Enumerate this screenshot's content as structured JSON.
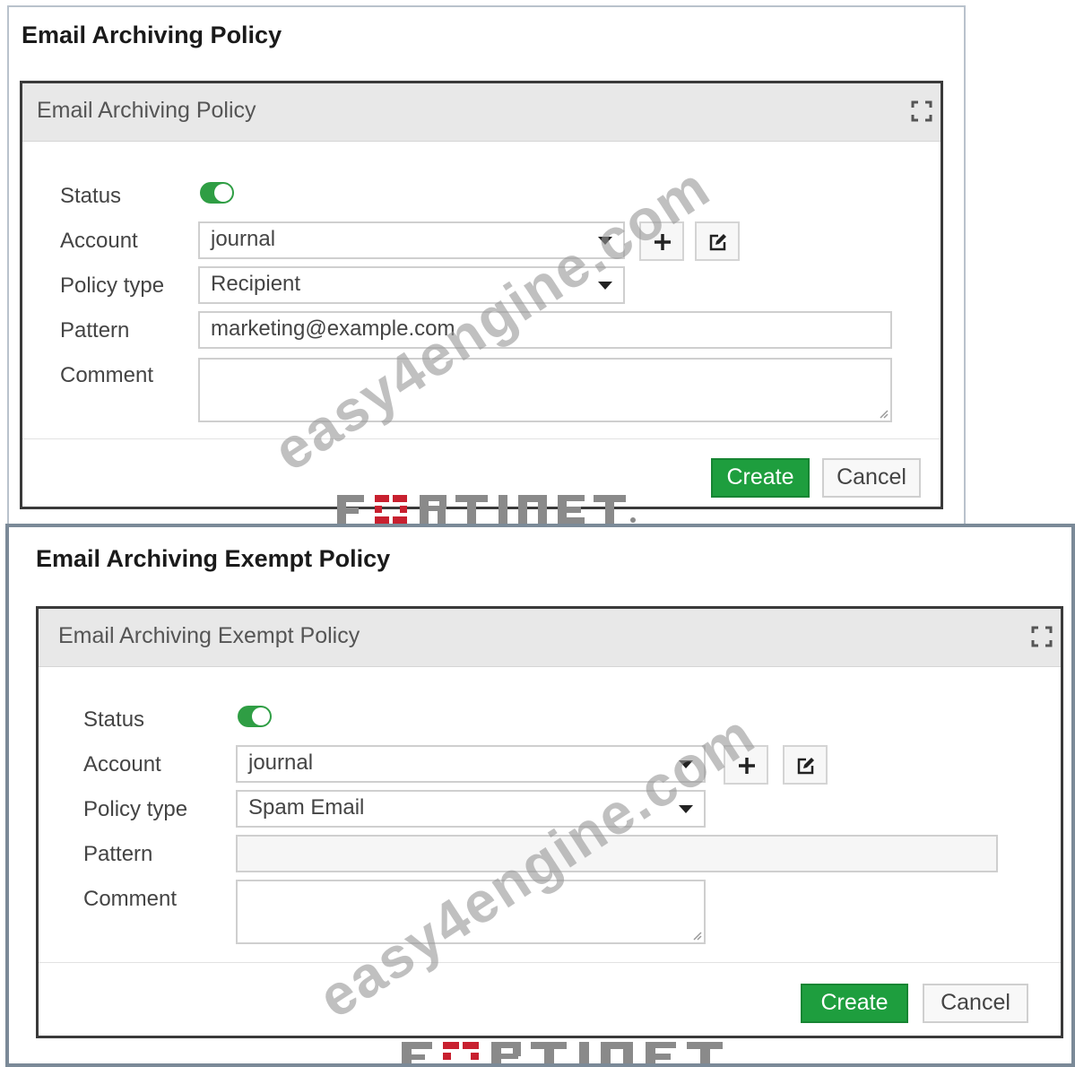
{
  "archiving_policy": {
    "panel_title": "Email Archiving Policy",
    "dialog_title": "Email Archiving Policy",
    "labels": {
      "status": "Status",
      "account": "Account",
      "policy_type": "Policy type",
      "pattern": "Pattern",
      "comment": "Comment"
    },
    "status_enabled": true,
    "account_value": "journal",
    "policy_type_value": "Recipient",
    "pattern_value": "marketing@example.com",
    "comment_value": "",
    "create_label": "Create",
    "cancel_label": "Cancel"
  },
  "exempt_policy": {
    "panel_title": "Email Archiving Exempt Policy",
    "dialog_title": "Email Archiving Exempt Policy",
    "labels": {
      "status": "Status",
      "account": "Account",
      "policy_type": "Policy type",
      "pattern": "Pattern",
      "comment": "Comment"
    },
    "status_enabled": true,
    "account_value": "journal",
    "policy_type_value": "Spam Email",
    "pattern_value": "",
    "comment_value": "",
    "create_label": "Create",
    "cancel_label": "Cancel"
  },
  "logo_text": "FORTINET",
  "watermark_text": "easy4engine.com",
  "colors": {
    "accent_green": "#1e9e3e",
    "toggle_green": "#2f9e44",
    "frame_blue_gray": "#7b8a98",
    "fortinet_red": "#c8202f"
  },
  "icons": {
    "add": "plus-icon",
    "edit": "edit-icon",
    "expand": "expand-icon",
    "dropdown": "chevron-down-icon"
  }
}
